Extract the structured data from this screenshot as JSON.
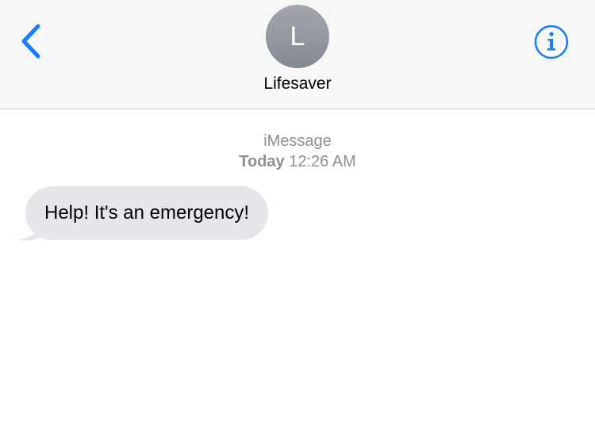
{
  "header": {
    "back_icon": "chevron-left-icon",
    "avatar_initial": "L",
    "contact_name": "Lifesaver",
    "info_icon": "info-circle-icon",
    "accent_color": "#147efb"
  },
  "thread": {
    "service": "iMessage",
    "day": "Today",
    "time": "12:26 AM"
  },
  "messages": [
    {
      "direction": "incoming",
      "text": "Help! It's an emergency!"
    }
  ],
  "colors": {
    "incoming_bubble": "#e5e5ea",
    "header_background": "#f7f7f7",
    "meta_text": "#8e8e93"
  }
}
